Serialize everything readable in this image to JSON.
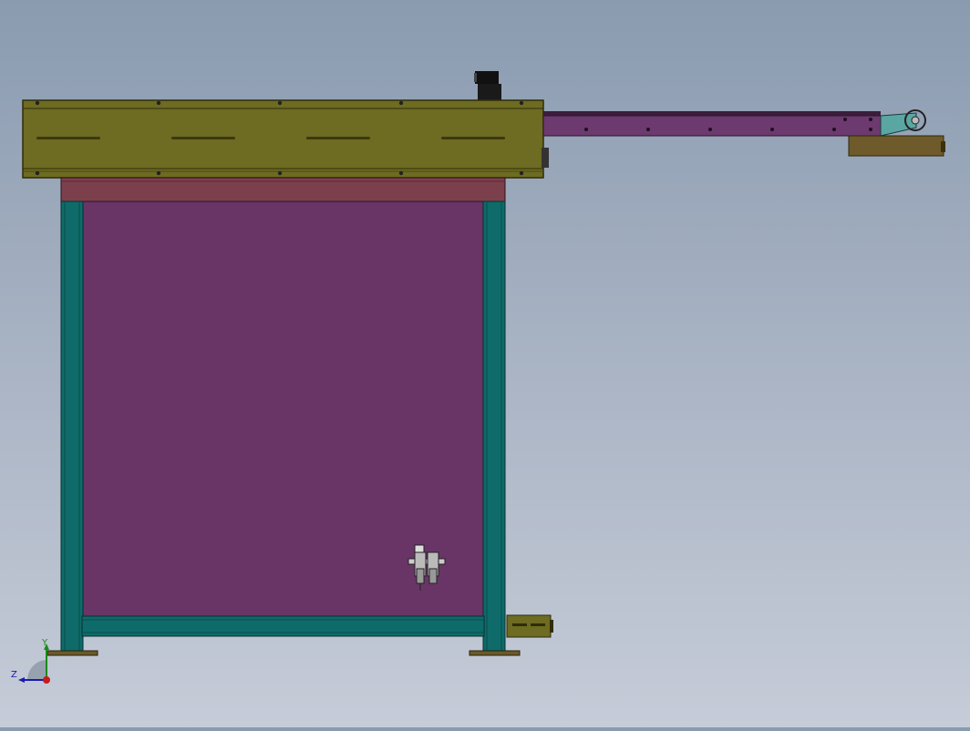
{
  "viewport": {
    "colors": {
      "background_top": "#8a9bb0",
      "background_bottom": "#c6ccd8",
      "top_housing": "#6e6b22",
      "top_housing_edge": "#2f2d0a",
      "conveyor_arm": "#6c3a6e",
      "conveyor_block": "#6e5a2a",
      "red_beam": "#7c404c",
      "panel": "#683566",
      "frame_teal": "#0e6b6a",
      "foot": "#6b5a2a",
      "motor": "#1a1a1a"
    },
    "components": [
      {
        "name": "motor",
        "icon": "motor-icon"
      },
      {
        "name": "top-housing",
        "icon": "housing"
      },
      {
        "name": "conveyor-arm",
        "icon": "belt"
      },
      {
        "name": "frame",
        "icon": "frame"
      },
      {
        "name": "air-filter-regulator",
        "icon": "frl-icon"
      },
      {
        "name": "side-bracket",
        "icon": "bracket"
      }
    ]
  },
  "triad": {
    "y_label": "Y",
    "z_label": "Z",
    "icon": "axis-triad-icon"
  }
}
